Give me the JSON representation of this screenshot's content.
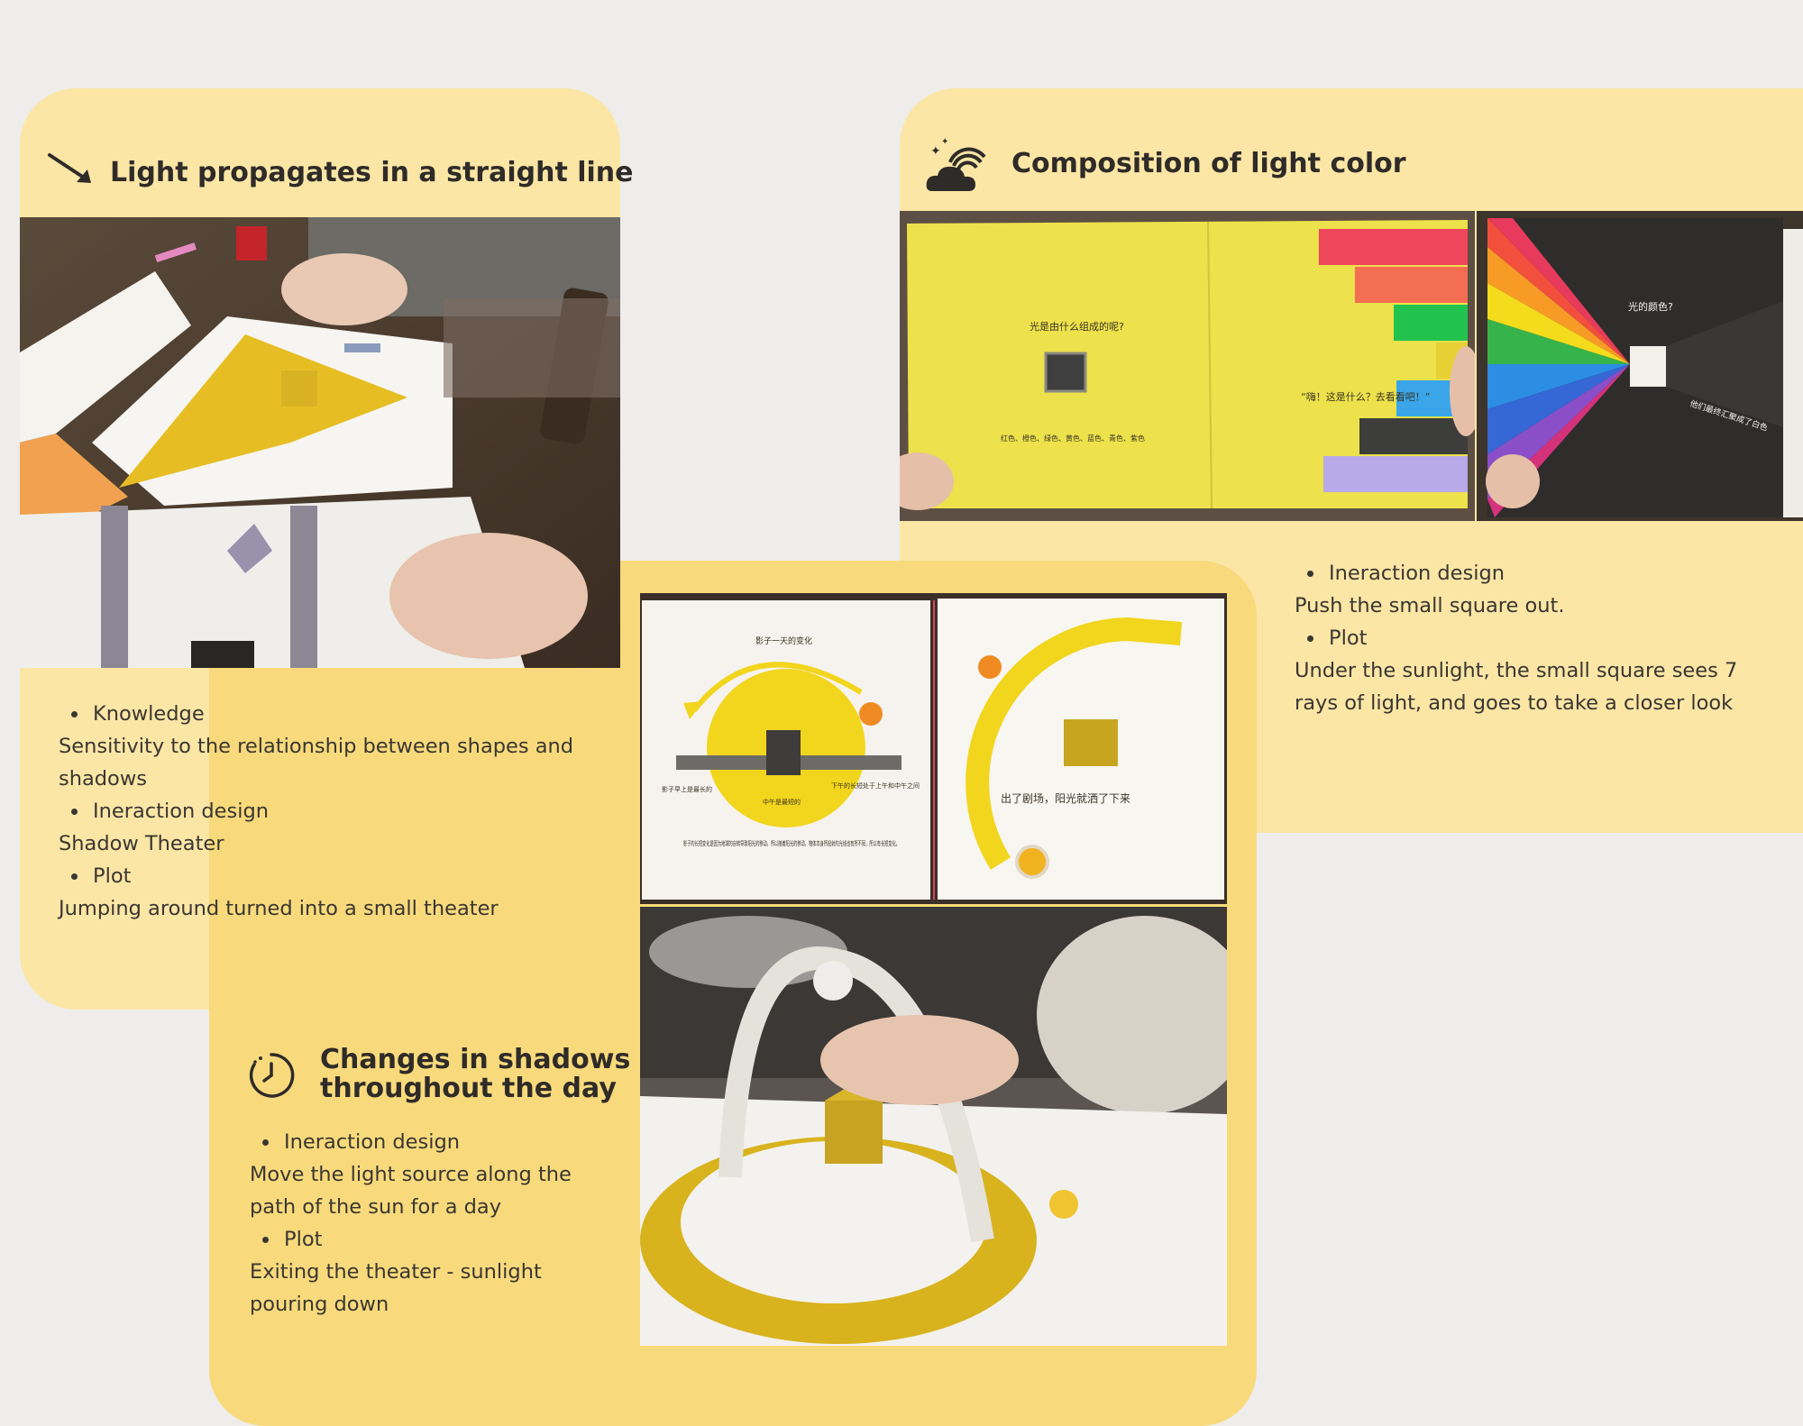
{
  "cards": {
    "straight": {
      "title": "Light propagates in a straight line",
      "icon": "diagonal-arrow-icon",
      "items": [
        {
          "heading": "Knowledge",
          "text": " Sensitivity to the relationship between shapes and shadows"
        },
        {
          "heading": "Ineraction design",
          "text": "Shadow Theater"
        },
        {
          "heading": "Plot",
          "text": "Jumping around turned into a small theater"
        }
      ]
    },
    "color": {
      "title": "Composition of light color",
      "icon": "rainbow-cloud-icon",
      "items": [
        {
          "heading": "Ineraction design",
          "text": "Push the small square out."
        },
        {
          "heading": "Plot",
          "text": "Under the sunlight, the small square sees 7 rays of light, and goes to take a closer look"
        }
      ]
    },
    "shadows": {
      "title_line1": "Changes in shadows",
      "title_line2": "throughout the day",
      "icon": "clock-icon",
      "items": [
        {
          "heading": "Ineraction design",
          "text": "Move the light source along the path of the sun for a day"
        },
        {
          "heading": "Plot",
          "text": "Exiting the theater - sunlight pouring down"
        }
      ]
    }
  },
  "photos": {
    "color_book_left": {
      "question": "光是由什么组成的呢?",
      "caption": "红色、橙色、绿色、黄色、蓝色、青色、紫色",
      "speech": "“嗨！这是什么？去看看吧！”"
    },
    "color_book_right": {
      "question": "光的颜色?",
      "caption": "他们最终汇聚成了白色"
    },
    "day_book_left": {
      "title": "影子一天的变化",
      "left": "影子早上是最长的",
      "middle": "中午是最短的",
      "right": "下午的长短处于上午和中午之间",
      "body": "影子的长短变化是因为地球的自转导致阳光的移动。所以随着阳光的移动，物体本身所投射的光线也有所不同，所以有长短变化。"
    },
    "day_book_right": {
      "caption": "出了剧场，阳光就洒了下来"
    }
  },
  "colors": {
    "page_bg": "#efedeb",
    "card_light": "#fbe6a6",
    "card_center": "#f8da7c",
    "accent_yellow": "#f0c623"
  }
}
